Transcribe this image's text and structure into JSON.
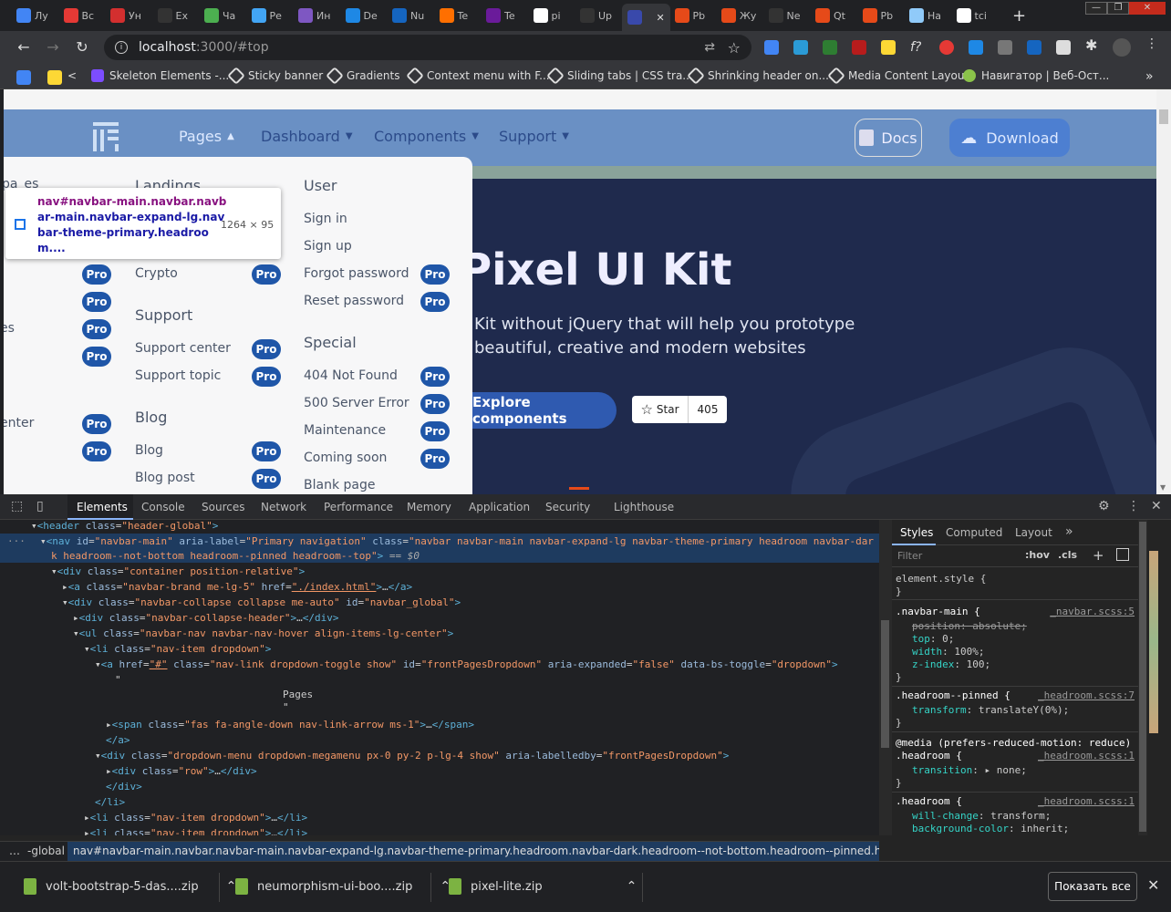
{
  "tabs": [
    {
      "label": "Лу",
      "color": "#4285f4"
    },
    {
      "label": "Вс",
      "color": "#e53935"
    },
    {
      "label": "Ун",
      "color": "#d32f2f"
    },
    {
      "label": "Ex",
      "color": "#333"
    },
    {
      "label": "Ча",
      "color": "#4caf50"
    },
    {
      "label": "Ре",
      "color": "#42a5f5"
    },
    {
      "label": "Ин",
      "color": "#7e57c2"
    },
    {
      "label": "Dе",
      "color": "#1e88e5"
    },
    {
      "label": "Nu",
      "color": "#1565c0"
    },
    {
      "label": "Te",
      "color": "#ff6f00"
    },
    {
      "label": "Te",
      "color": "#6a1b9a"
    },
    {
      "label": "pi",
      "color": "#ffffff"
    },
    {
      "label": "Up",
      "color": "#333"
    },
    {
      "label": "",
      "color": "#3949ab",
      "active": true
    },
    {
      "label": "Рb",
      "color": "#e64a19"
    },
    {
      "label": "Жу",
      "color": "#e64a19"
    },
    {
      "label": "Ne",
      "color": "#333"
    },
    {
      "label": "Qt",
      "color": "#e64a19"
    },
    {
      "label": "Рb",
      "color": "#e64a19"
    },
    {
      "label": "На",
      "color": "#90caf9"
    },
    {
      "label": "tci",
      "color": "#ffffff"
    }
  ],
  "url": {
    "host": "localhost",
    "rest": ":3000/#top"
  },
  "bookmarks": [
    "<",
    "Skeleton Elements -...",
    "Sticky banner",
    "Gradients",
    "Context menu with F...",
    "Sliding tabs | CSS tra...",
    "Shrinking header on...",
    "Media Content Layout",
    "Навигатор | Веб-Ост..."
  ],
  "site": {
    "nav": [
      "Pages",
      "Dashboard",
      "Components",
      "Support"
    ],
    "docs": "Docs",
    "download": "Download",
    "hero_title": "Pixel UI Kit",
    "hero_sub1": "Kit without jQuery that will help you prototype",
    "hero_sub2": "beautiful, creative and modern websites",
    "explore": "Explore components",
    "star": "Star",
    "star_count": "405",
    "pro": "Pro"
  },
  "megamenu": {
    "col1": {
      "heading": "pa_es",
      "labels": [
        "es",
        "enter"
      ]
    },
    "col2": {
      "h1": "Landings",
      "i1": [
        "Crypto"
      ],
      "h2": "Support",
      "i2": [
        "Support center",
        "Support topic"
      ],
      "h3": "Blog",
      "i3": [
        "Blog",
        "Blog post"
      ]
    },
    "col3": {
      "h1": "User",
      "i1": [
        "Sign in",
        "Sign up",
        "Forgot password",
        "Reset password"
      ],
      "h2": "Special",
      "i2": [
        "404 Not Found",
        "500 Server Error",
        "Maintenance",
        "Coming soon",
        "Blank page"
      ]
    }
  },
  "tooltip": {
    "selector": "nav#navbar-main.navbar.navbar-main.navbar-expand-lg.navbar-theme-primary.headroom....",
    "line1": "nav#navbar-main.navbar.navb",
    "line2": "ar-main.navbar-expand-lg.nav",
    "line3": "bar-theme-primary.headroo",
    "line4": "m....",
    "size": "1264 × 95"
  },
  "devtools": {
    "tabs": [
      "Elements",
      "Console",
      "Sources",
      "Network",
      "Performance",
      "Memory",
      "Application",
      "Security",
      "Lighthouse"
    ],
    "style_tabs": [
      "Styles",
      "Computed",
      "Layout"
    ],
    "filter": "Filter",
    "hov": ":hov",
    "cls": ".cls",
    "crumb1": "-global",
    "crumb2": "nav#navbar-main.navbar.navbar-main.navbar-expand-lg.navbar-theme-primary.headroom.navbar-dark.headroom--not-bottom.headroom--pinned.headroom--top"
  },
  "downloads": [
    "volt-bootstrap-5-das....zip",
    "neumorphism-ui-boo....zip",
    "pixel-lite.zip"
  ],
  "show_all": "Показать все"
}
